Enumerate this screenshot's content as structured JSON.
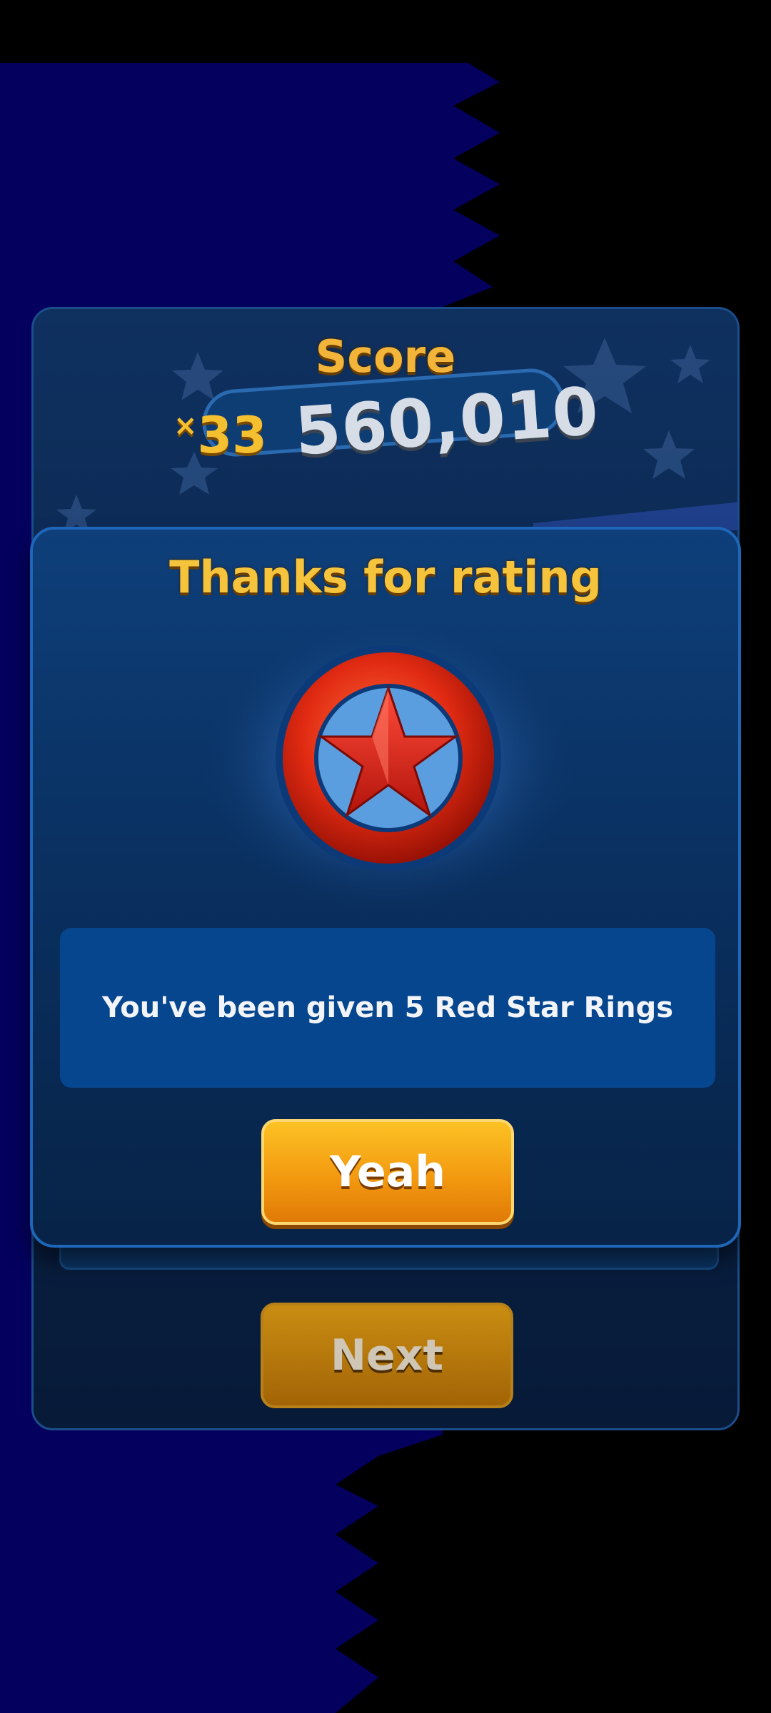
{
  "score_panel": {
    "title": "Score",
    "multiplier": "33",
    "multiplier_prefix": "×",
    "score": "560,010",
    "next_label": "Next"
  },
  "dialog": {
    "title": "Thanks for rating",
    "reward_icon": "red-star-ring-icon",
    "message": "You've been given 5 Red Star Rings",
    "confirm_label": "Yeah"
  },
  "colors": {
    "background_blue": "#04005e",
    "gold_text": "#f6c43c",
    "button_orange": "#f39a10",
    "ring_red": "#e02a12"
  }
}
